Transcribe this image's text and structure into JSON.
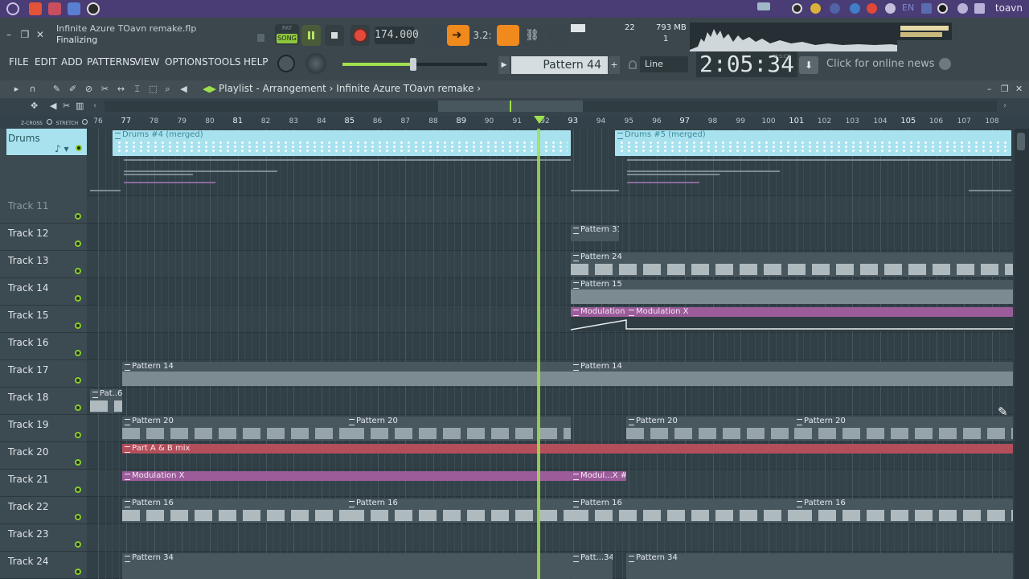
{
  "system": {
    "user": "toavn",
    "taskbar_icons": [
      "app-menu-icon",
      "brave-icon",
      "toolbox-icon",
      "window-icon",
      "obs-icon"
    ],
    "tray_icons": [
      "camera-icon",
      "torch-icon",
      "nordic-icon",
      "steam-icon",
      "brave-tray-icon",
      "volume-icon",
      "keyboard-icon",
      "network-icon",
      "obs-tray-icon",
      "gear-icon",
      "display-icon"
    ],
    "tray_lang": "EN"
  },
  "project": {
    "file_name": "Infinite Azure TOavn remake.flp",
    "status": "Finalizing"
  },
  "menu": [
    "FILE",
    "EDIT",
    "ADD",
    "PATTERNS",
    "VIEW",
    "OPTIONS",
    "TOOLS",
    "HELP"
  ],
  "transport": {
    "pat_label": "PAT",
    "song_label": "SONG",
    "tempo": "174.000",
    "count_label": "3.2:",
    "cpu_voices": "22",
    "memory": "793 MB",
    "polyphony": "1"
  },
  "pattern": {
    "current": "Pattern 44",
    "add_label": "+",
    "snap": "Line"
  },
  "time": {
    "display": "2:05:34",
    "tag": "M:S:CS"
  },
  "news": {
    "label": "Click for online news"
  },
  "playlist": {
    "title": "Playlist - Arrangement",
    "song": "Infinite Azure TOavn remake",
    "left_controls": [
      "Z-CROSS",
      "STRETCH"
    ]
  },
  "ruler": {
    "bars": [
      "76",
      "77",
      "78",
      "79",
      "80",
      "81",
      "82",
      "83",
      "84",
      "85",
      "86",
      "87",
      "88",
      "89",
      "90",
      "91",
      "92",
      "93",
      "94",
      "95",
      "96",
      "97",
      "98",
      "99",
      "100",
      "101",
      "102",
      "103",
      "104",
      "105",
      "106",
      "107",
      "108"
    ],
    "major": [
      "77",
      "81",
      "85",
      "89",
      "93",
      "97",
      "101",
      "105"
    ]
  },
  "tracks": [
    {
      "name": "Drums",
      "sub": "♪ ▾"
    },
    {
      "name": "Track 11",
      "dim": true
    },
    {
      "name": "Track 12"
    },
    {
      "name": "Track 13"
    },
    {
      "name": "Track 14"
    },
    {
      "name": "Track 15"
    },
    {
      "name": "Track 16"
    },
    {
      "name": "Track 17"
    },
    {
      "name": "Track 18"
    },
    {
      "name": "Track 19"
    },
    {
      "name": "Track 20"
    },
    {
      "name": "Track 21"
    },
    {
      "name": "Track 22"
    },
    {
      "name": "Track 23"
    },
    {
      "name": "Track 24"
    }
  ],
  "clips": {
    "drums_a": "Drums #4 (merged)",
    "drums_b": "Drums #5 (merged)",
    "p31": "Pattern 31",
    "p24": "Pattern 24",
    "p15": "Pattern 15",
    "mod_a": "Modulation X",
    "mod_b": "Modulation X",
    "p14_a": "Pattern 14",
    "p14_b": "Pattern 14",
    "pat6": "Pat..6",
    "p20_a": "Pattern 20",
    "p20_b": "Pattern 20",
    "p20_c": "Pattern 20",
    "p20_d": "Pattern 20",
    "ab_mix": "Part A & B mix",
    "mod_c": "Modulation X",
    "mod_d": "Modul...X #2",
    "p16_a": "Pattern 16",
    "p16_b": "Pattern 16",
    "p16_c": "Pattern 16",
    "p16_d": "Pattern 16",
    "p34_a": "Pattern 34",
    "p34_b": "Patt...34",
    "p34_c": "Pattern 34"
  },
  "colors": {
    "accent_green": "#9fe04e",
    "accent_orange": "#f08a1d",
    "drums_clip": "#a9e2ef",
    "automation_purple": "#9c5c9a",
    "automation_red": "#b34e5b"
  }
}
